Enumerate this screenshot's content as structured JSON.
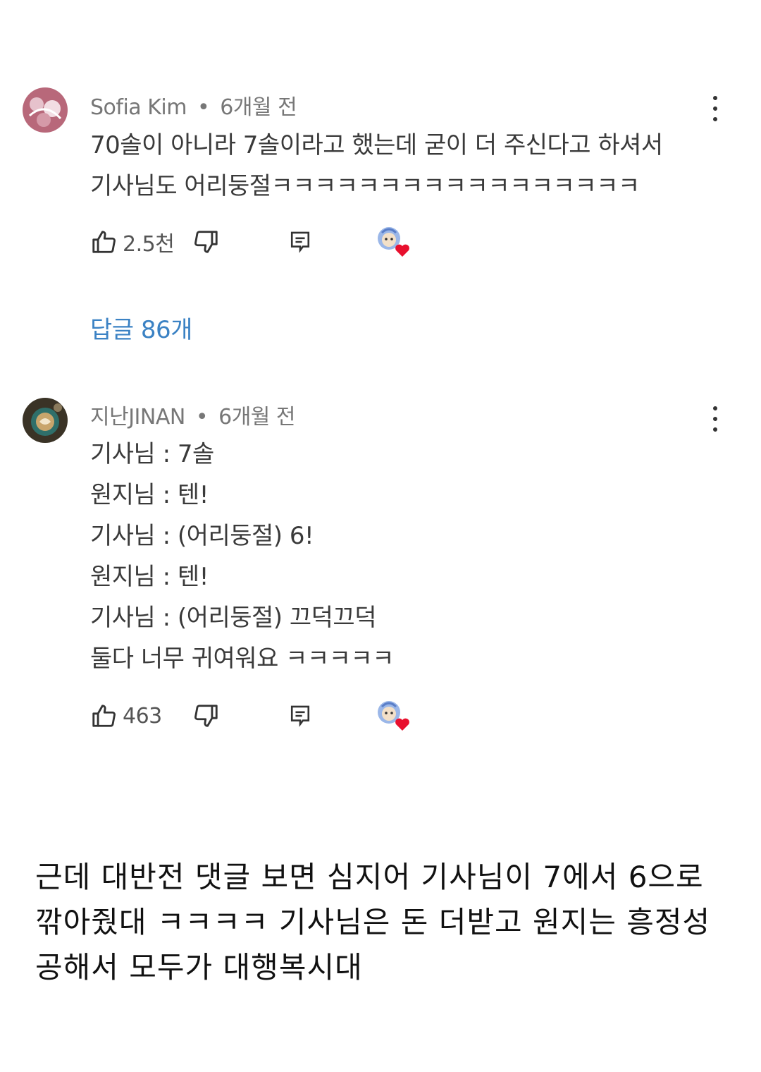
{
  "comments": [
    {
      "author": "Sofia Kim",
      "time": "6개월 전",
      "lines": [
        "70솔이 아니라 7솔이라고 했는데 굳이 더 주신다고 하셔서",
        "기사님도 어리둥절ㅋㅋㅋㅋㅋㅋㅋㅋㅋㅋㅋㅋㅋㅋㅋㅋㅋ"
      ],
      "likes": "2.5천",
      "replies": "답글 86개"
    },
    {
      "author": "지난JINAN",
      "time": "6개월 전",
      "lines": [
        "기사님 : 7솔",
        "원지님 : 텐!",
        "기사님 : (어리둥절) 6!",
        "원지님 : 텐!",
        "기사님 : (어리둥절) 끄덕끄덕",
        "둘다 너무 귀여워요 ㅋㅋㅋㅋㅋ"
      ],
      "likes": "463"
    }
  ],
  "meta_separator": "•",
  "caption": "근데 대반전 댓글 보면 심지어 기사님이 7에서 6으로 깎아줬대 ㅋㅋㅋㅋ 기사님은 돈 더받고 원지는 흥정성공해서 모두가 대행복시대",
  "icons": [
    "thumbs-up-icon",
    "thumbs-down-icon",
    "reply-icon",
    "creator-heart-icon",
    "more-vert-icon"
  ],
  "colors": {
    "link": "#3b82c4",
    "heart": "#e8102e"
  }
}
